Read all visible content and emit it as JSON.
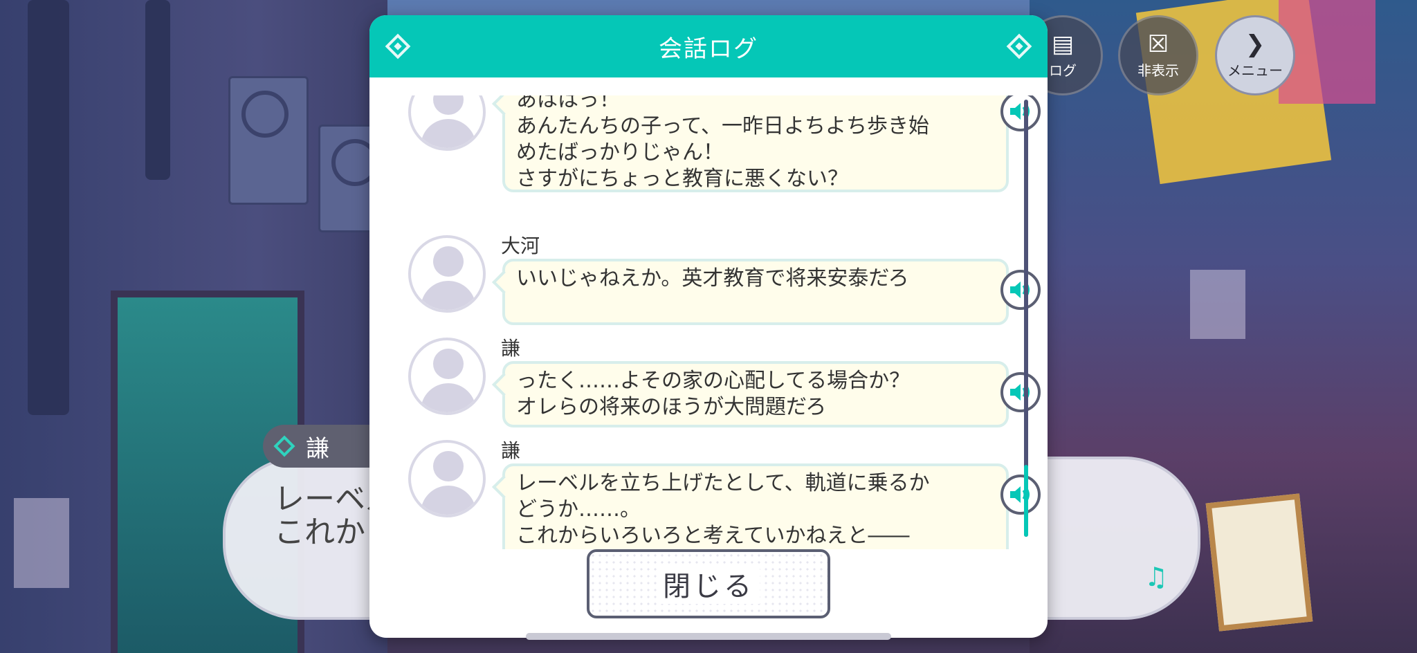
{
  "modal": {
    "title": "会話ログ",
    "close_label": "閉じる"
  },
  "hud": {
    "log_label": "ログ",
    "hide_label": "非表示",
    "menu_label": "メニュー"
  },
  "log_entries": [
    {
      "speaker": "",
      "text": "あははっ！\nあんたんちの子って、一昨日よちよち歩き始\nめたばっかりじゃん！\nさすがにちょっと教育に悪くない？"
    },
    {
      "speaker": "大河",
      "text": "いいじゃねえか。英才教育で将来安泰だろ"
    },
    {
      "speaker": "謙",
      "text": "ったく……よその家の心配してる場合か？\nオレらの将来のほうが大問題だろ"
    },
    {
      "speaker": "謙",
      "text": "レーベルを立ち上げたとして、軌道に乗るか\nどうか……。\nこれからいろいろと考えていかねえと――"
    }
  ],
  "dialogue": {
    "speaker": "謙",
    "text": "レーベル\nこれから"
  },
  "colors": {
    "accent": "#05c7b7",
    "bubble_bg": "#fffdeb",
    "bubble_border": "#d7eeeb"
  }
}
